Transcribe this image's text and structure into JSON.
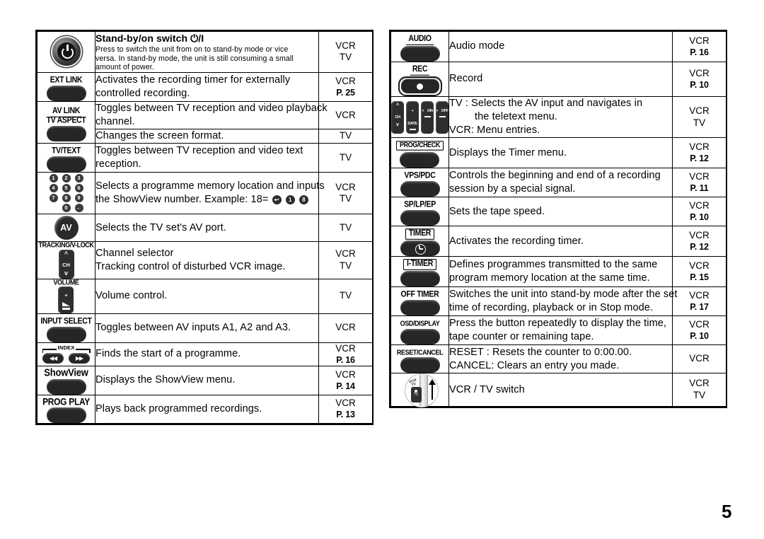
{
  "page": {
    "number": "5"
  },
  "columns": {
    "left": {
      "rows": [
        {
          "icon": "power-standby-button-icon",
          "icon_label": "",
          "title": "Stand-by/on switch ⏻/I",
          "desc_lines": [
            "Press to switch the unit from on to stand-by mode or vice",
            "versa. In stand-by mode, the unit is still consuming a small",
            "amount of power."
          ],
          "mode": "VCR",
          "mode2": "TV",
          "page_ref": ""
        },
        {
          "icon": "ext-link-button-icon",
          "icon_label": "EXT LINK",
          "desc_lines": [
            "Activates the recording timer for externally",
            "controlled recording."
          ],
          "mode": "VCR",
          "mode2": "",
          "page_ref": "P. 25"
        },
        {
          "icon": "av-link-tv-aspect-button-icon",
          "icon_label": "AV LINK",
          "icon_label2": "TV ASPECT",
          "split": true,
          "desc_lines_a": [
            "Toggles between TV reception and video playback",
            "channel."
          ],
          "mode_a": "VCR",
          "desc_lines_b": [
            "Changes the screen format."
          ],
          "mode_b": "TV"
        },
        {
          "icon": "tv-text-button-icon",
          "icon_label": "TV/TEXT",
          "desc_lines": [
            "Toggles between TV reception and video text",
            "reception."
          ],
          "mode": "TV",
          "mode2": "",
          "page_ref": ""
        },
        {
          "icon": "numeric-keypad-icon",
          "icon_label": "",
          "desc_lines": [
            "Selects a programme memory location and inputs",
            "the ShowView number. Example:  18="
          ],
          "example_keys": [
            "↩",
            "1",
            "8"
          ],
          "mode": "VCR",
          "mode2": "TV",
          "page_ref": ""
        },
        {
          "icon": "av-button-icon",
          "icon_label": "AV",
          "desc_lines": [
            "Selects the TV set's AV port."
          ],
          "mode": "TV",
          "mode2": "",
          "page_ref": ""
        },
        {
          "icon": "tracking-v-lock-channel-rocker-icon",
          "icon_label": "TRACKING/V-LOCK",
          "rocker_label": "CH",
          "desc_lines": [
            "Channel selector",
            "Tracking control of disturbed VCR image."
          ],
          "mode": "VCR",
          "mode2": "TV",
          "page_ref": ""
        },
        {
          "icon": "volume-rocker-icon",
          "icon_label": "VOLUME",
          "desc_lines": [
            "Volume control."
          ],
          "mode": "TV",
          "mode2": "",
          "page_ref": ""
        },
        {
          "icon": "input-select-button-icon",
          "icon_label": "INPUT SELECT",
          "desc_lines": [
            "Toggles between AV inputs A1, A2 and A3."
          ],
          "mode": "VCR",
          "mode2": "",
          "page_ref": ""
        },
        {
          "icon": "index-skip-buttons-icon",
          "icon_label": "INDEX",
          "desc_lines": [
            "Finds the start of a programme."
          ],
          "mode": "VCR",
          "mode2": "",
          "page_ref": "P. 16"
        },
        {
          "icon": "showview-button-icon",
          "icon_label": "ShowView",
          "desc_lines": [
            "Displays the ShowView menu."
          ],
          "mode": "VCR",
          "mode2": "",
          "page_ref": "P. 14"
        },
        {
          "icon": "prog-play-button-icon",
          "icon_label": "PROG PLAY",
          "desc_lines": [
            "Plays back programmed recordings."
          ],
          "mode": "VCR",
          "mode2": "",
          "page_ref": "P. 13"
        }
      ]
    },
    "right": {
      "rows": [
        {
          "icon": "audio-button-icon",
          "icon_label": "AUDIO",
          "desc_lines": [
            "Audio mode"
          ],
          "mode": "VCR",
          "mode2": "",
          "page_ref": "P. 16"
        },
        {
          "icon": "record-button-icon",
          "icon_label": "REC",
          "desc_lines": [
            "Record"
          ],
          "mode": "VCR",
          "mode2": "",
          "page_ref": "P. 10"
        },
        {
          "icon": "four-rocker-cluster-icon",
          "icon_label": "",
          "rocker_labels": [
            "CH",
            "DATE",
            "ON",
            "OFF"
          ],
          "desc_lines": [
            "TV   : Selects the AV input and navigates in",
            "the teletext menu.",
            "VCR: Menu entries."
          ],
          "desc_indent_index": 1,
          "mode": "VCR",
          "mode2": "TV",
          "page_ref": ""
        },
        {
          "icon": "prog-check-button-icon",
          "icon_label": "PROG/CHECK",
          "desc_lines": [
            "Displays the Timer menu."
          ],
          "mode": "VCR",
          "mode2": "",
          "page_ref": "P. 12"
        },
        {
          "icon": "vps-pdc-button-icon",
          "icon_label": "VPS/PDC",
          "desc_lines": [
            "Controls the beginning and end of a recording",
            "session by a special signal."
          ],
          "mode": "VCR",
          "mode2": "",
          "page_ref": "P. 11"
        },
        {
          "icon": "sp-lp-ep-button-icon",
          "icon_label": "SP/LP/EP",
          "desc_lines": [
            "Sets the tape speed."
          ],
          "mode": "VCR",
          "mode2": "",
          "page_ref": "P. 10"
        },
        {
          "icon": "timer-button-icon",
          "icon_label": "TIMER",
          "desc_lines": [
            "Activates the recording timer."
          ],
          "mode": "VCR",
          "mode2": "",
          "page_ref": "P. 12"
        },
        {
          "icon": "i-timer-button-icon",
          "icon_label": "I-TIMER",
          "desc_lines": [
            "Defines programmes transmitted to the same",
            "program memory location at the same time."
          ],
          "mode": "VCR",
          "mode2": "",
          "page_ref": "P. 15"
        },
        {
          "icon": "off-timer-button-icon",
          "icon_label": "OFF TIMER",
          "desc_lines": [
            "Switches the unit into stand-by mode after the set",
            "time of recording, playback or in Stop mode."
          ],
          "mode": "VCR",
          "mode2": "",
          "page_ref": "P. 17"
        },
        {
          "icon": "osd-display-button-icon",
          "icon_label": "OSD/DISPLAY",
          "desc_lines": [
            "Press the button repeatedly to display the time,",
            "tape counter or remaining tape."
          ],
          "mode": "VCR",
          "mode2": "",
          "page_ref": "P. 10"
        },
        {
          "icon": "reset-cancel-button-icon",
          "icon_label": "RESET/CANCEL",
          "desc_lines": [
            "RESET   : Resets the counter to 0:00.00.",
            "CANCEL: Clears an entry you made."
          ],
          "mode": "VCR",
          "mode2": "",
          "page_ref": ""
        },
        {
          "icon": "vcr-tv-slide-switch-icon",
          "icon_label": "",
          "switch_top_label": "VCR",
          "switch_top_label2": "TV",
          "switch_knob_label": "VCR",
          "switch_knob_label2": "TV",
          "desc_lines": [
            "VCR / TV switch"
          ],
          "mode": "VCR",
          "mode2": "TV",
          "page_ref": ""
        }
      ]
    }
  }
}
